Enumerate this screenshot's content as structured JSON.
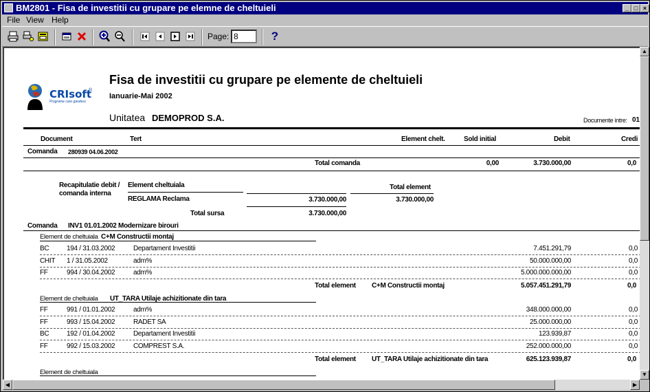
{
  "window": {
    "title": "BM2801 - Fisa de investitii cu grupare pe elemne de cheltuieli"
  },
  "menu": {
    "file": "File",
    "view": "View",
    "help": "Help"
  },
  "toolbar": {
    "page_label": "Page:",
    "page_value": "8",
    "help": "?"
  },
  "report": {
    "logo_text": "CRIsoft",
    "logo_sup": "®",
    "logo_tagline": "Programe care gandesc",
    "title": "Fisa de investitii cu grupare pe elemente de cheltuieli",
    "period": "Ianuarie-Mai 2002",
    "unit_label": "Unitatea",
    "unit_name": "DEMOPROD S.A.",
    "docs_label": "Documente intre:",
    "docs_value": "01",
    "headers": {
      "document": "Document",
      "tert": "Tert",
      "element": "Element chelt.",
      "sold": "Sold initial",
      "debit": "Debit",
      "credit": "Credi"
    },
    "cmd1": {
      "label": "Comanda",
      "value": "280939 04.06.2002",
      "total_label": "Total comanda",
      "total_sold": "0,00",
      "total_debit": "3.730.000,00",
      "total_credit": "0,0"
    },
    "recap": {
      "label1": "Recapitulatie debit /",
      "label2": "comanda interna",
      "col_elem": "Element cheltuiala",
      "col_total": "Total element",
      "row_elem": "REGLAMA Reclama",
      "row_value": "3.730.000,00",
      "row_total": "3.730.000,00",
      "sursa_label": "Total sursa",
      "sursa_value": "3.730.000,00"
    },
    "cmd2": {
      "label": "Comanda",
      "value": "INV1 01.01.2002 Modernizare birouri"
    },
    "elem1": {
      "label": "Element de cheltuiala",
      "code": "C+M Constructii montaj",
      "rows": [
        {
          "type": "BC",
          "doc": "194 / 31.03.2002",
          "tert": "Departament Investitii",
          "debit": "7.451.291,79",
          "credit": "0,0"
        },
        {
          "type": "CHIT",
          "doc": "1 / 31.05.2002",
          "tert": "adm%",
          "debit": "50.000.000,00",
          "credit": "0,0"
        },
        {
          "type": "FF",
          "doc": "994 / 30.04.2002",
          "tert": "adm%",
          "debit": "5.000.000.000,00",
          "credit": "0,0"
        }
      ],
      "total_label": "Total element",
      "total_name": "C+M Constructii montaj",
      "total_debit": "5.057.451.291,79",
      "total_credit": "0,0"
    },
    "elem2": {
      "label": "Element de cheltuiala",
      "code": "UT_TARA Utilaje achizitionate din tara",
      "rows": [
        {
          "type": "FF",
          "doc": "991 / 01.01.2002",
          "tert": "adm%",
          "debit": "348.000.000,00",
          "credit": "0,0"
        },
        {
          "type": "FF",
          "doc": "993 / 15.04.2002",
          "tert": "RADET SA",
          "debit": "25.000.000,00",
          "credit": "0,0"
        },
        {
          "type": "BC",
          "doc": "192 / 01.04.2002",
          "tert": "Departament Investitii",
          "debit": "123.939,87",
          "credit": "0,0"
        },
        {
          "type": "FF",
          "doc": "992 / 15.03.2002",
          "tert": "COMPREST S.A.",
          "debit": "252.000.000,00",
          "credit": "0,0"
        }
      ],
      "total_label": "Total element",
      "total_name": "UT_TARA Utilaje achizitionate din tara",
      "total_debit": "625.123.939,87",
      "total_credit": "0,0"
    },
    "elem3": {
      "label": "Element de cheltuiala"
    }
  }
}
